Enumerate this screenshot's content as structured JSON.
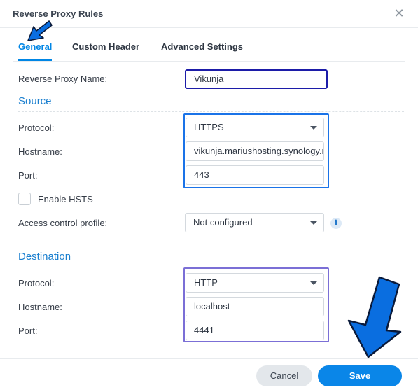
{
  "dialog": {
    "title": "Reverse Proxy Rules",
    "close_glyph": "✕"
  },
  "tabs": [
    {
      "label": "General",
      "active": true
    },
    {
      "label": "Custom Header",
      "active": false
    },
    {
      "label": "Advanced Settings",
      "active": false
    }
  ],
  "general": {
    "name_label": "Reverse Proxy Name:",
    "name_value": "Vikunja"
  },
  "source": {
    "title": "Source",
    "protocol_label": "Protocol:",
    "protocol_value": "HTTPS",
    "hostname_label": "Hostname:",
    "hostname_value": "vikunja.mariushosting.synology.me",
    "port_label": "Port:",
    "port_value": "443",
    "hsts_label": "Enable HSTS",
    "hsts_checked": false,
    "acl_label": "Access control profile:",
    "acl_value": "Not configured"
  },
  "destination": {
    "title": "Destination",
    "protocol_label": "Protocol:",
    "protocol_value": "HTTP",
    "hostname_label": "Hostname:",
    "hostname_value": "localhost",
    "port_label": "Port:",
    "port_value": "4441"
  },
  "footer": {
    "cancel_label": "Cancel",
    "save_label": "Save"
  },
  "icons": {
    "info": "i",
    "accent_color": "#0086e5",
    "highlight_source": "#1a73e8",
    "highlight_name": "#1c1ca8",
    "highlight_destination": "#7b6fd6"
  }
}
